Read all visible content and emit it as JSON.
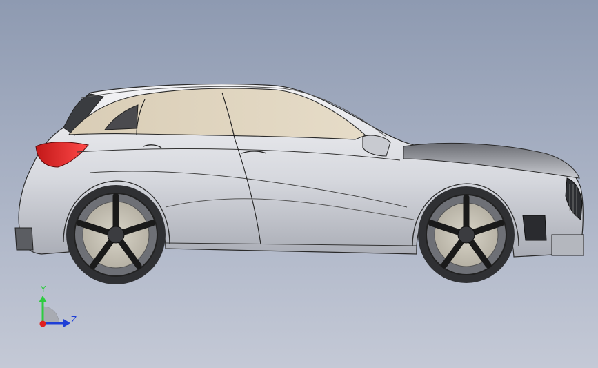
{
  "viewport": {
    "background_top": "#8e9ab1",
    "background_bottom": "#c4c9d6",
    "model": "car-side-view"
  },
  "triad": {
    "y_label": "Y",
    "z_label": "Z",
    "y_color": "#2ecc40",
    "z_color": "#1f3fd6",
    "x_color": "#e02020"
  }
}
